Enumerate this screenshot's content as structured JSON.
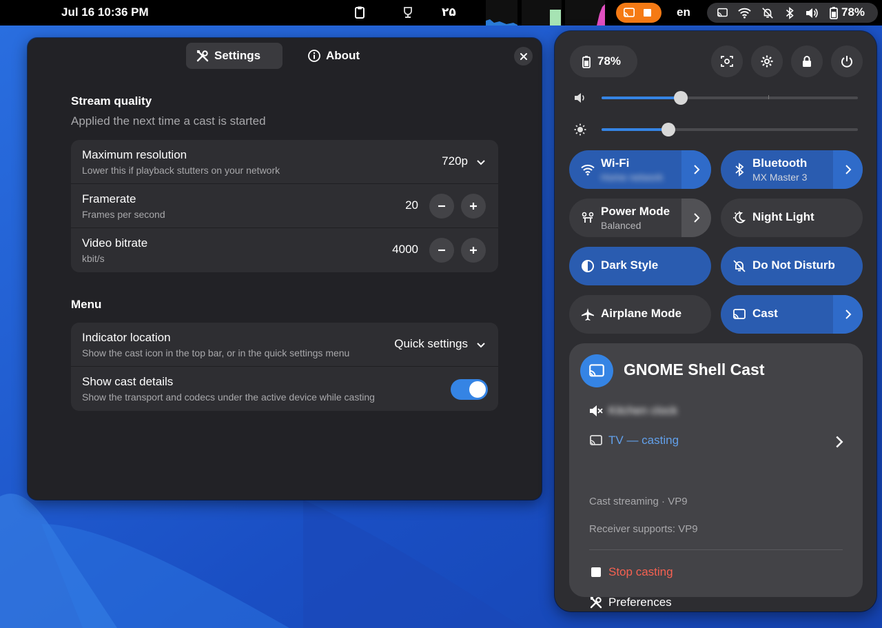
{
  "topbar": {
    "datetime": "Jul 16  10:36 PM",
    "workspace_number": "۲۵",
    "language": "en",
    "battery_percent": "78%",
    "cast_pill_color": "#f57a14"
  },
  "prefs_window": {
    "tabs": [
      {
        "label": "Settings",
        "icon": "tools-icon",
        "active": true
      },
      {
        "label": "About",
        "icon": "info-icon",
        "active": false
      }
    ],
    "stream_quality": {
      "title": "Stream quality",
      "subtitle": "Applied the next time a cast is started",
      "rows": {
        "resolution": {
          "title": "Maximum resolution",
          "subtitle": "Lower this if playback stutters on your network",
          "value": "720p"
        },
        "framerate": {
          "title": "Framerate",
          "subtitle": "Frames per second",
          "value": "20"
        },
        "bitrate": {
          "title": "Video bitrate",
          "subtitle": "kbit/s",
          "value": "4000"
        }
      }
    },
    "menu": {
      "title": "Menu",
      "rows": {
        "indicator": {
          "title": "Indicator location",
          "subtitle": "Show the cast icon in the top bar, or in the quick settings menu",
          "value": "Quick settings"
        },
        "details": {
          "title": "Show cast details",
          "subtitle": "Show the transport and codecs under the active device while casting",
          "enabled": true
        }
      }
    }
  },
  "quick_settings": {
    "battery_percent": "78%",
    "volume_level": 0.31,
    "brightness_level": 0.26,
    "tiles": {
      "wifi": {
        "title": "Wi-Fi",
        "subtitle": "Home network",
        "on": true
      },
      "bluetooth": {
        "title": "Bluetooth",
        "subtitle": "MX Master 3",
        "on": true
      },
      "power": {
        "title": "Power Mode",
        "subtitle": "Balanced",
        "on": false
      },
      "night": {
        "title": "Night Light",
        "on": false
      },
      "dark": {
        "title": "Dark Style",
        "on": true
      },
      "dnd": {
        "title": "Do Not Disturb",
        "on": true
      },
      "airplane": {
        "title": "Airplane Mode",
        "on": false
      },
      "cast": {
        "title": "Cast",
        "on": true
      }
    },
    "cast_menu": {
      "title": "GNOME Shell Cast",
      "speaker_device": "Kitchen clock",
      "tv_device": "TV — casting",
      "stream_info": "Cast streaming · VP9",
      "receiver_info": "Receiver supports: VP9",
      "stop_label": "Stop casting",
      "prefs_label": "Preferences",
      "accent_color": "#3584e4",
      "stop_color": "#f66151"
    }
  }
}
